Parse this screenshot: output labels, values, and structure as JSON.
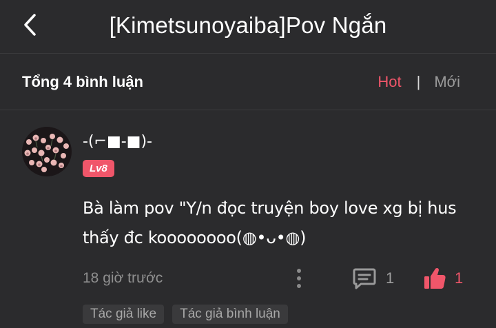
{
  "header": {
    "title": "[Kimetsunoyaiba]Pov Ngắn",
    "back_icon": "chevron-left-icon"
  },
  "subbar": {
    "total_label": "Tổng 4 bình luận",
    "sort_hot": "Hot",
    "sort_separator": "|",
    "sort_new": "Mới",
    "active_sort": "Hot"
  },
  "comment": {
    "username": "-(⌐■-■)-",
    "level_badge": "Lv8",
    "text": "Bà làm pov \"Y/n đọc truyện boy love xg bị hus thấy đc koooooooo(◍•ᴗ•◍)",
    "time": "18 giờ trước",
    "reply_count": "1",
    "like_count": "1",
    "tags": [
      "Tác giả like",
      "Tác giả bình luận"
    ]
  },
  "colors": {
    "background": "#2b2b2d",
    "accent": "#f0566a",
    "muted_text": "#8f8f8f",
    "tag_bg": "#3a3a3c"
  }
}
